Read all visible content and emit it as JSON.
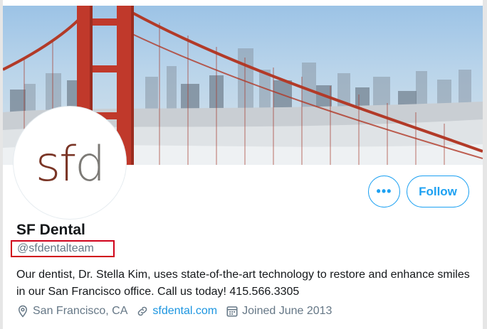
{
  "profile": {
    "name": "SF Dental",
    "handle": "@sfdentalteam",
    "avatar_text_1": "sf",
    "avatar_text_2": "d",
    "bio": "Our dentist, Dr. Stella Kim, uses state-of-the-art technology to restore and enhance smiles in our San Francisco office. Call us today! 415.566.3305",
    "location": "San Francisco, CA",
    "website": "sfdental.com",
    "joined": "Joined June 2013"
  },
  "actions": {
    "more_label": "•••",
    "follow_label": "Follow"
  },
  "icons": {
    "location": "location-pin-icon",
    "website": "link-icon",
    "joined": "calendar-icon",
    "more": "more-dots-icon"
  },
  "colors": {
    "accent": "#1da1f2",
    "highlight_box": "#d0021b",
    "secondary_text": "#657786"
  }
}
